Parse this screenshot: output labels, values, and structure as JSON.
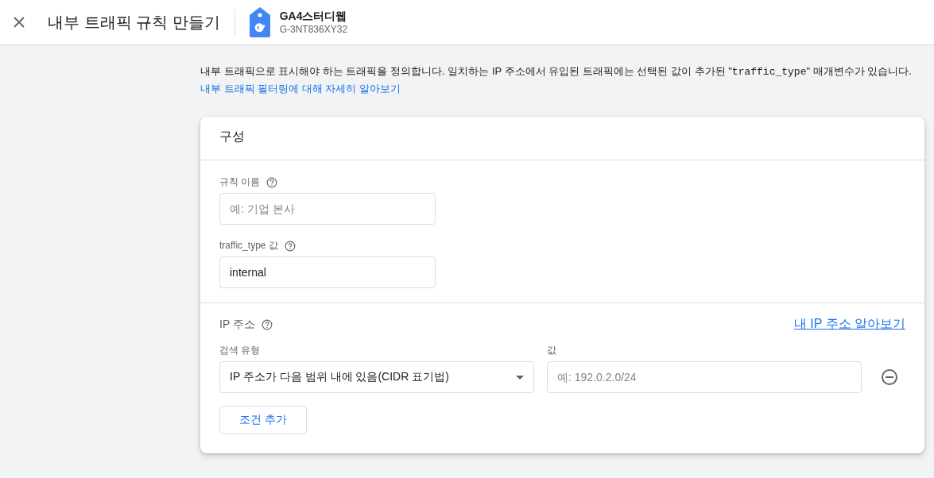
{
  "header": {
    "title": "내부 트래픽 규칙 만들기",
    "property_name": "GA4스터디웹",
    "property_id": "G-3NT836XY32"
  },
  "description": {
    "before": "내부 트래픽으로 표시해야 하는 트래픽을 정의합니다. 일치하는 IP 주소에서 유입된 트래픽에는 선택된 값이 추가된 \"",
    "code": "traffic_type",
    "after": "\" 매개변수가 있습니다. ",
    "link": "내부 트래픽 필터링에 대해 자세히 알아보기"
  },
  "card": {
    "title": "구성",
    "fields": [
      {
        "label": "규칙 이름",
        "placeholder": "예: 기업 본사"
      },
      {
        "label": "traffic_type 값",
        "value": "internal"
      }
    ],
    "ip": {
      "title": "IP 주소",
      "link": "내 IP 주소 알아보기",
      "match_label": "검색 유형",
      "value_label": "값",
      "conditions": [
        {
          "match": "IP 주소가 다음 범위 내에 있음(CIDR 표기법)",
          "placeholder": "예: 192.0.2.0/24"
        }
      ],
      "add_button": "조건 추가"
    }
  }
}
